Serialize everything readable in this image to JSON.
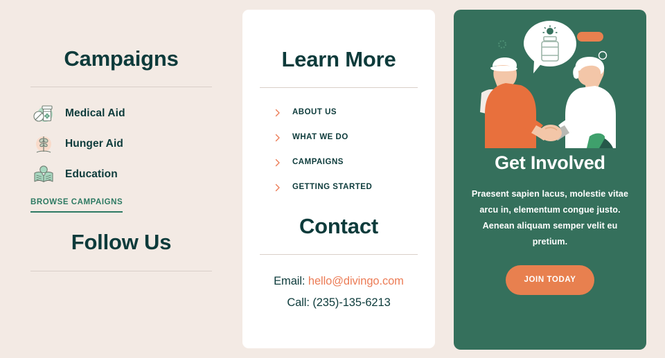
{
  "colors": {
    "page_background": "#f3eae4",
    "card_white": "#ffffff",
    "card_green": "#35705c",
    "heading_teal": "#0d3b3b",
    "accent_orange": "#e8804f",
    "link_salmon": "#ec7c56",
    "browse_green": "#2e7a63",
    "divider_gray": "#d9cfc8"
  },
  "campaigns": {
    "heading": "Campaigns",
    "items": [
      {
        "label": "Medical Aid",
        "icon": "pill-bottle-icon"
      },
      {
        "label": "Hunger Aid",
        "icon": "sprout-plant-icon"
      },
      {
        "label": "Education",
        "icon": "open-book-lightbulb-icon"
      }
    ],
    "browse_label": "BROWSE CAMPAIGNS"
  },
  "follow": {
    "heading": "Follow Us"
  },
  "learn_more": {
    "heading": "Learn More",
    "links": [
      {
        "label": "ABOUT US",
        "icon": "chevron-right-icon"
      },
      {
        "label": "WHAT WE DO",
        "icon": "chevron-right-icon"
      },
      {
        "label": "CAMPAIGNS",
        "icon": "chevron-right-icon"
      },
      {
        "label": "GETTING STARTED",
        "icon": "chevron-right-icon"
      }
    ]
  },
  "contact": {
    "heading": "Contact",
    "email_label": "Email:",
    "email_value": "hello@divingo.com",
    "phone_label": "Call:",
    "phone_value": "(235)-135-6213"
  },
  "get_involved": {
    "illustration": "handshake-donation-illustration",
    "title": "Get Involved",
    "body": "Praesent sapien lacus, molestie vitae arcu in, elementum congue justo. Aenean aliquam semper velit eu pretium.",
    "cta_label": "JOIN TODAY"
  }
}
